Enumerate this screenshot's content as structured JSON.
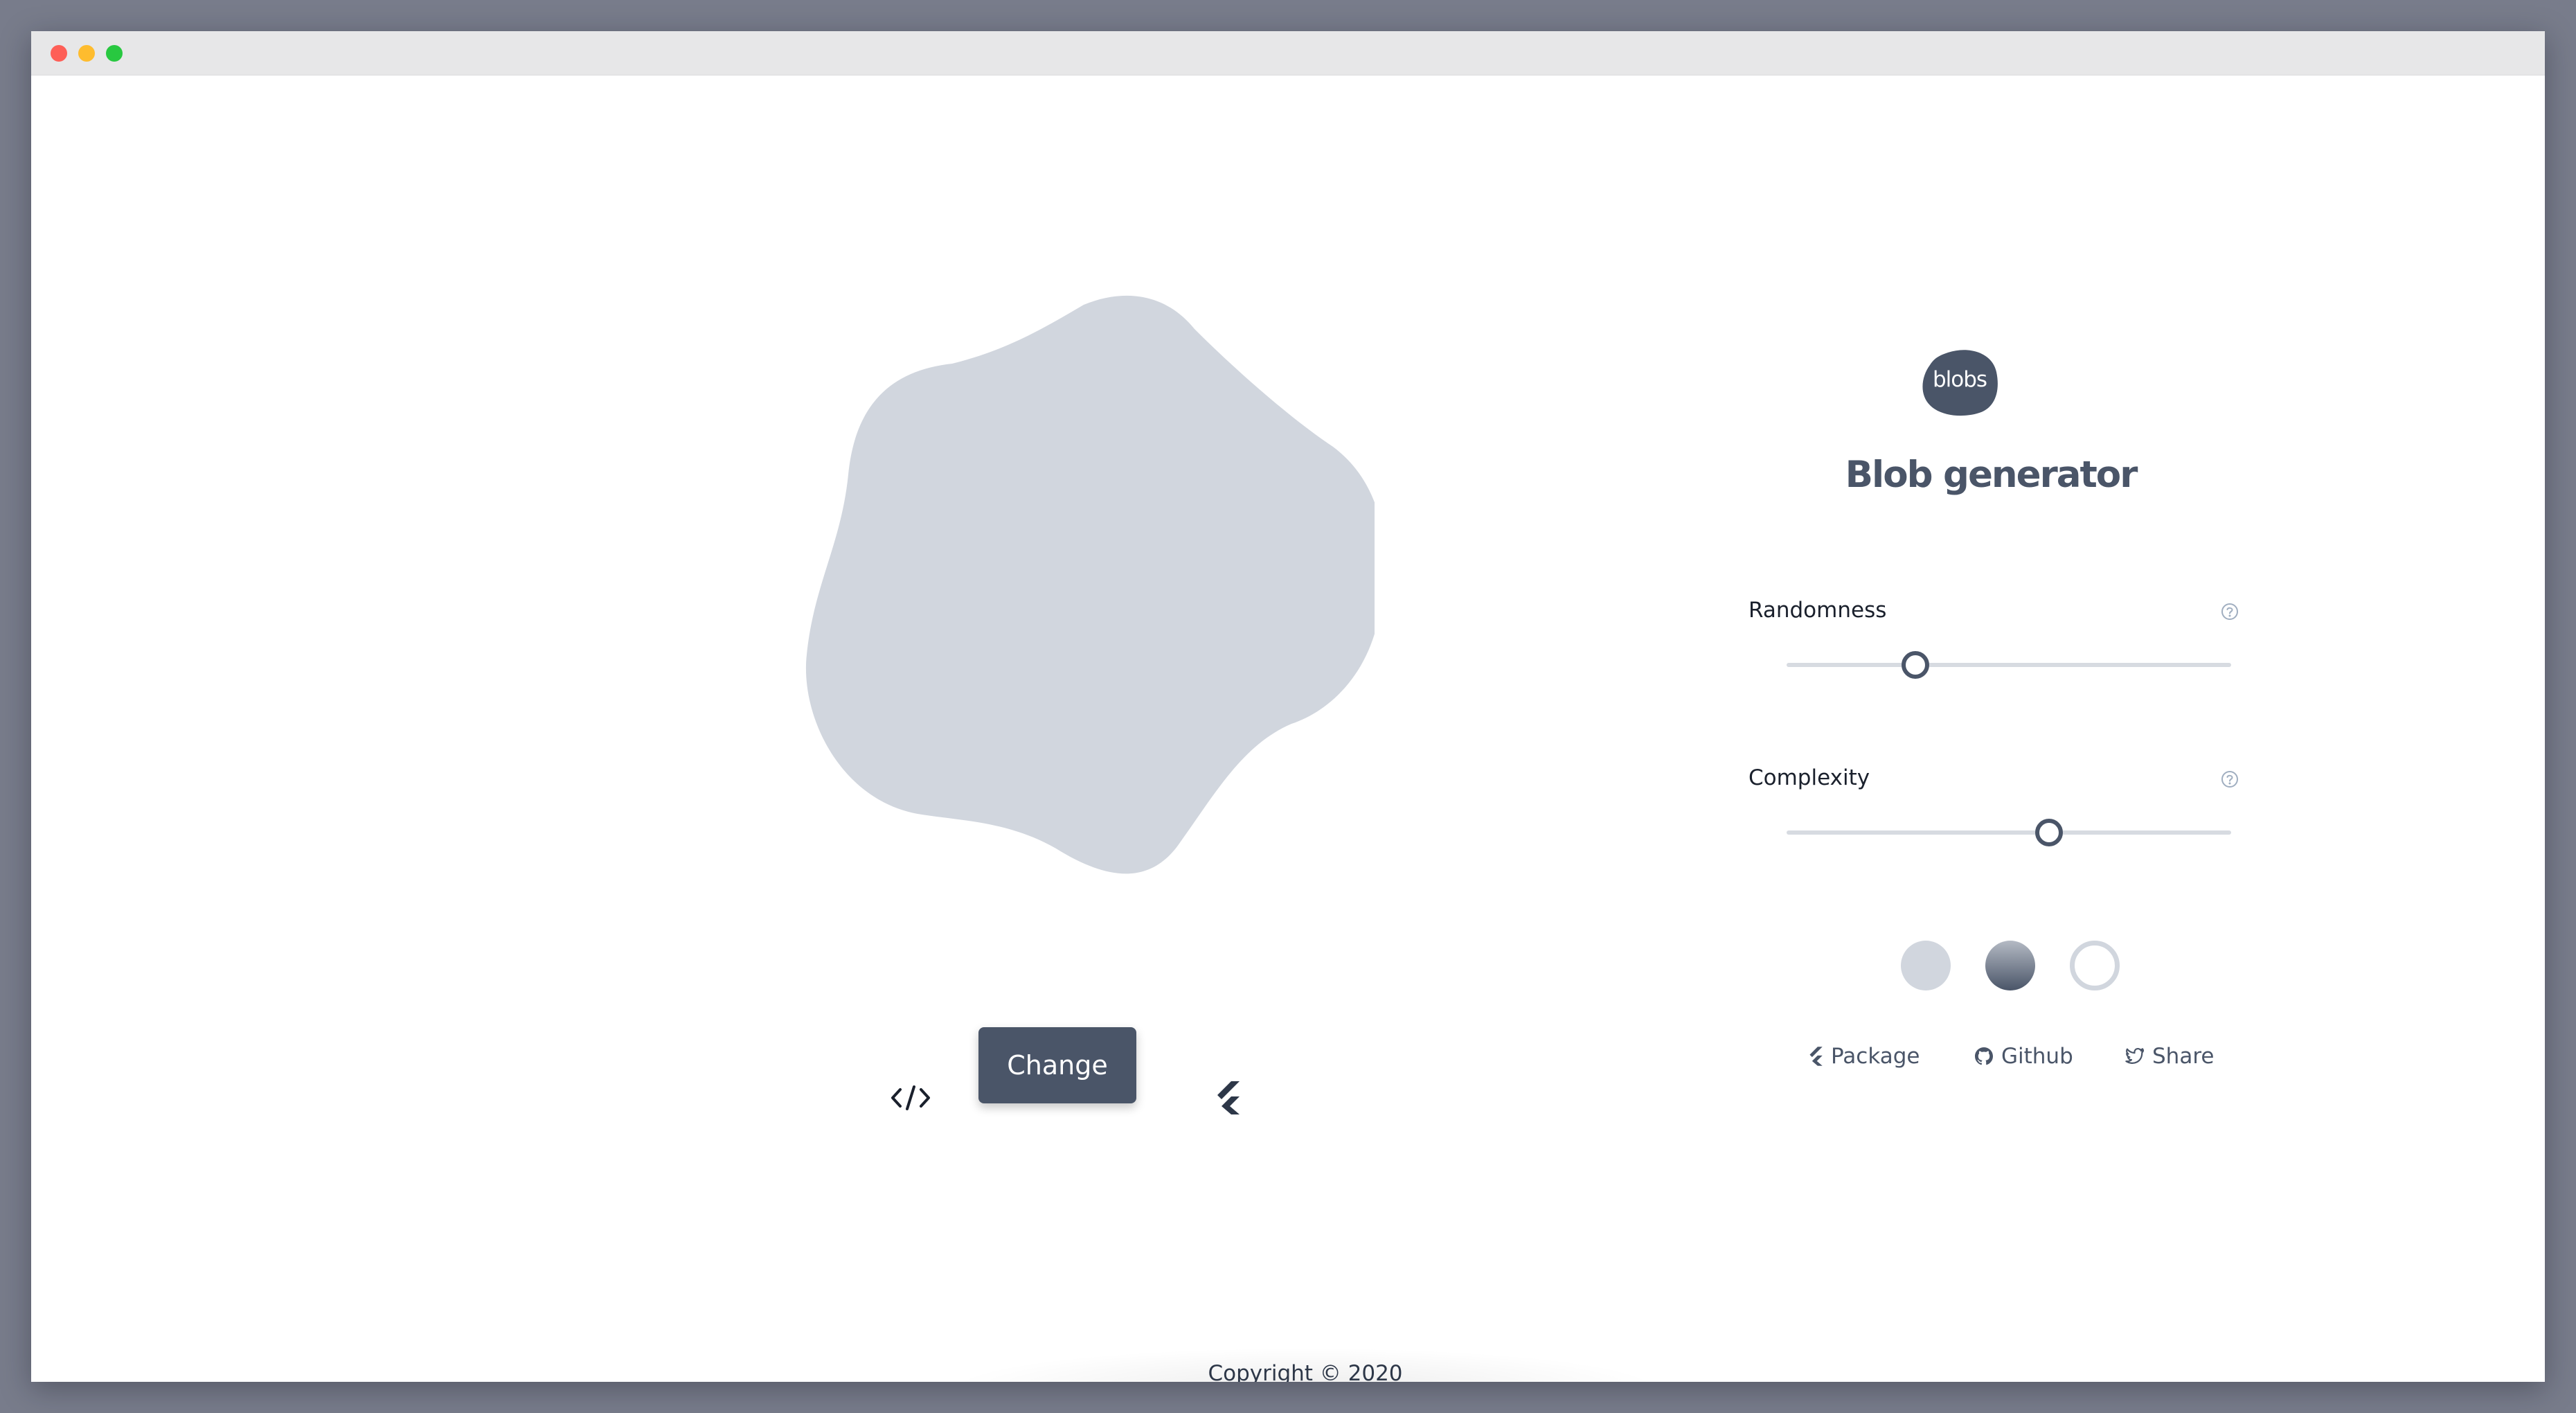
{
  "app": {
    "title": "Blob generator",
    "logo_text": "blobs"
  },
  "preview": {
    "blob_fill": "#d1d6de",
    "buttons": {
      "code_icon": "code-icon",
      "change_label": "Change",
      "flutter_icon": "flutter-icon"
    }
  },
  "controls": {
    "randomness": {
      "label": "Randomness",
      "value_fraction": 0.29,
      "help_icon": "help-circle-icon"
    },
    "complexity": {
      "label": "Complexity",
      "value_fraction": 0.59,
      "help_icon": "help-circle-icon"
    }
  },
  "fill_options": [
    {
      "name": "solid",
      "selected": false
    },
    {
      "name": "gradient",
      "selected": false
    },
    {
      "name": "outline",
      "selected": false
    }
  ],
  "links": {
    "package": {
      "label": "Package",
      "icon": "flutter-icon"
    },
    "github": {
      "label": "Github",
      "icon": "github-icon"
    },
    "share": {
      "label": "Share",
      "icon": "twitter-icon"
    }
  },
  "footer": {
    "text": "Copyright  ©  2020"
  },
  "colors": {
    "accent": "#4a5568",
    "blob": "#d1d6de",
    "track": "#d7dbe1"
  }
}
